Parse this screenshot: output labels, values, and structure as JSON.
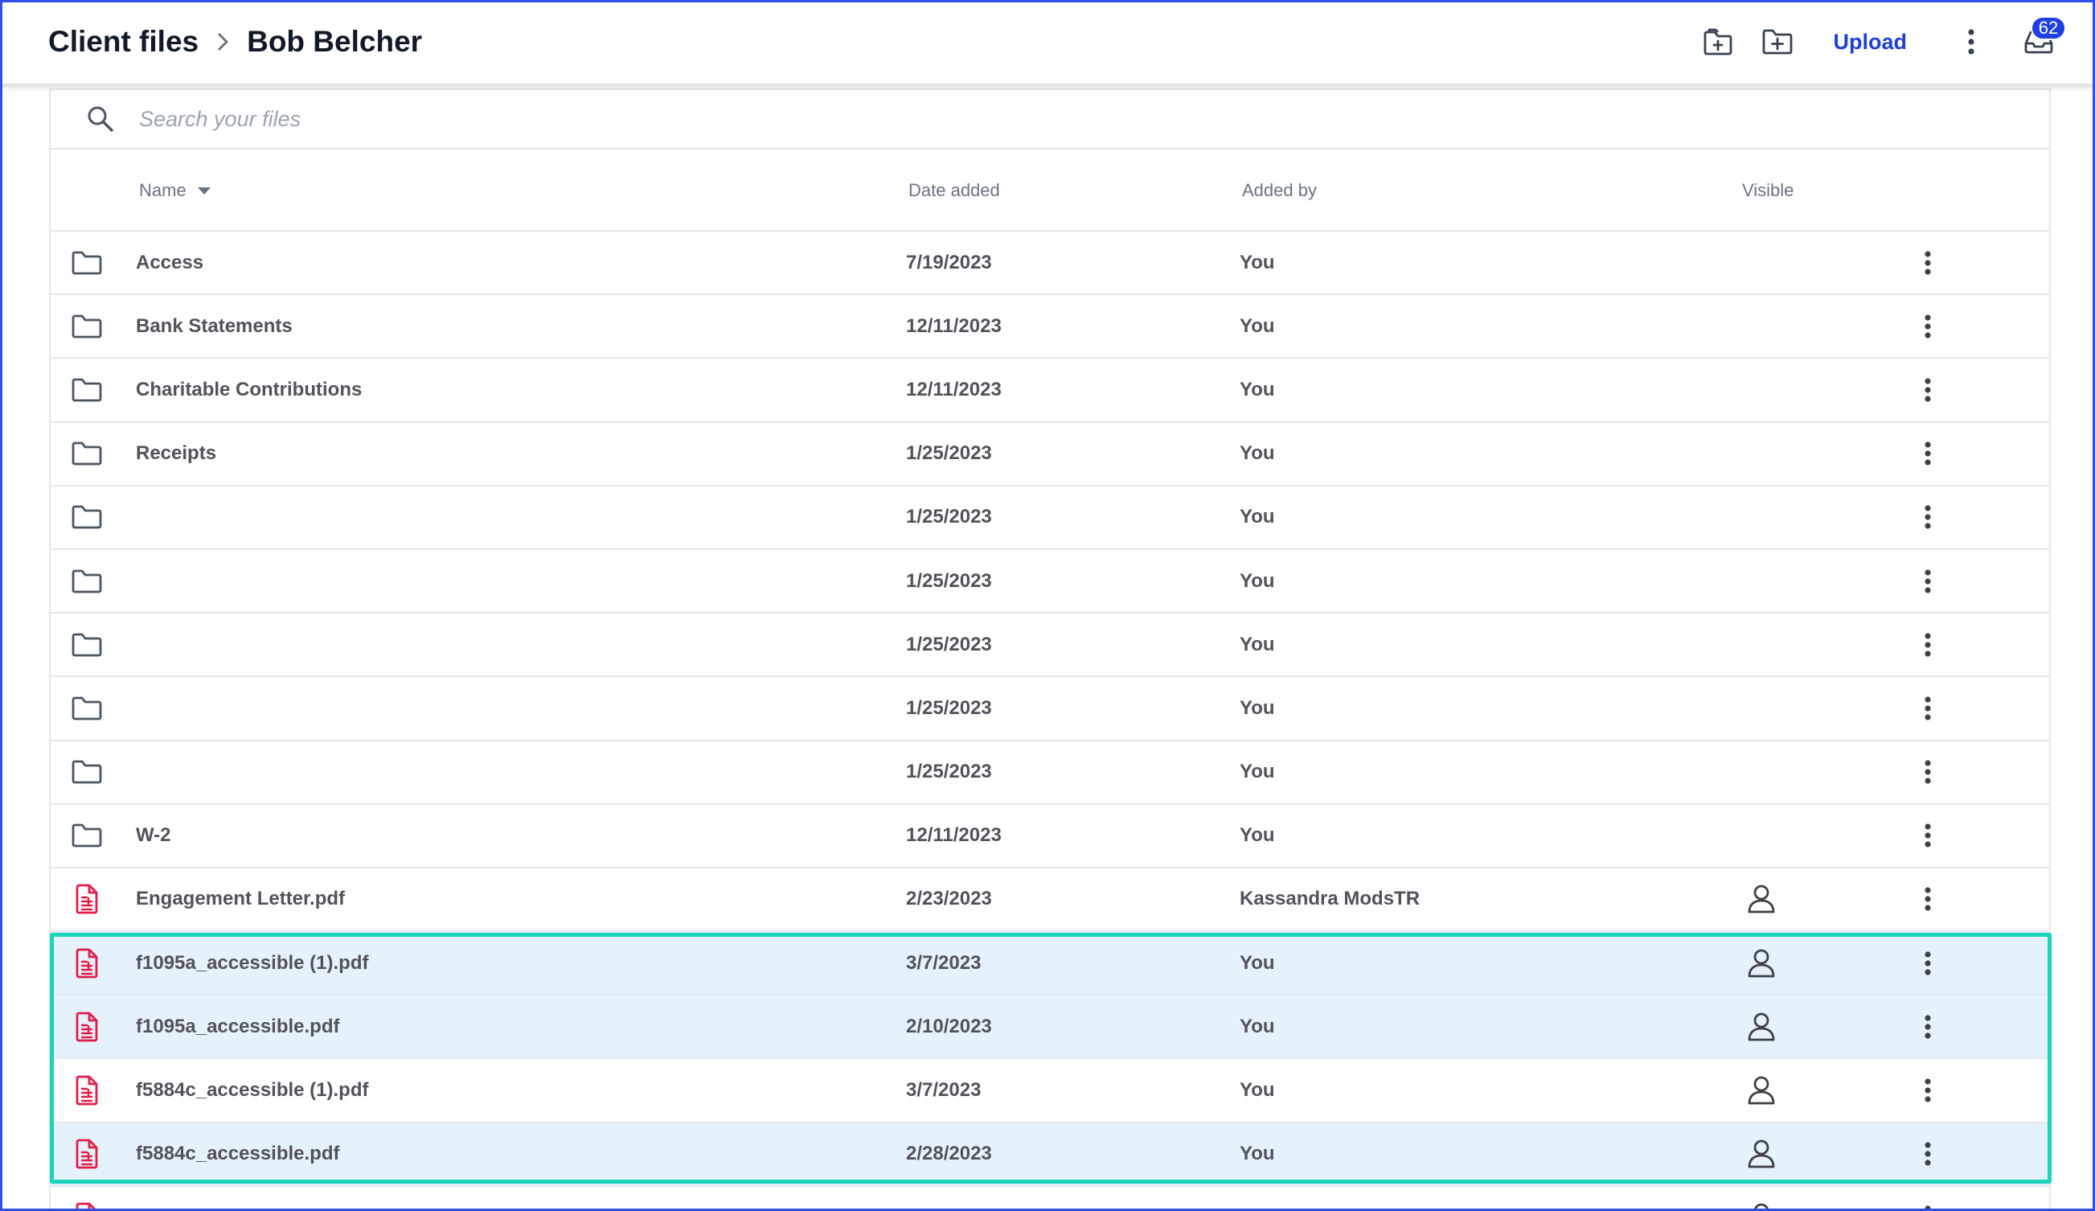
{
  "breadcrumb": {
    "root": "Client files",
    "current": "Bob Belcher"
  },
  "header": {
    "upload_label": "Upload",
    "inbox_count": "62"
  },
  "search": {
    "placeholder": "Search your files"
  },
  "columns": {
    "name": "Name",
    "date_added": "Date added",
    "added_by": "Added by",
    "visible": "Visible"
  },
  "rows": [
    {
      "type": "folder",
      "name": "Access",
      "date": "7/19/2023",
      "by": "You",
      "visible": false,
      "selected": false
    },
    {
      "type": "folder",
      "name": "Bank Statements",
      "date": "12/11/2023",
      "by": "You",
      "visible": false,
      "selected": false
    },
    {
      "type": "folder",
      "name": "Charitable Contributions",
      "date": "12/11/2023",
      "by": "You",
      "visible": false,
      "selected": false
    },
    {
      "type": "folder",
      "name": "Receipts",
      "date": "1/25/2023",
      "by": "You",
      "visible": false,
      "selected": false
    },
    {
      "type": "folder",
      "name": "",
      "date": "1/25/2023",
      "by": "You",
      "visible": false,
      "selected": false
    },
    {
      "type": "folder",
      "name": "",
      "date": "1/25/2023",
      "by": "You",
      "visible": false,
      "selected": false
    },
    {
      "type": "folder",
      "name": "",
      "date": "1/25/2023",
      "by": "You",
      "visible": false,
      "selected": false
    },
    {
      "type": "folder",
      "name": "",
      "date": "1/25/2023",
      "by": "You",
      "visible": false,
      "selected": false
    },
    {
      "type": "folder",
      "name": "",
      "date": "1/25/2023",
      "by": "You",
      "visible": false,
      "selected": false
    },
    {
      "type": "folder",
      "name": "W-2",
      "date": "12/11/2023",
      "by": "You",
      "visible": false,
      "selected": false
    },
    {
      "type": "pdf",
      "name": "Engagement Letter.pdf",
      "date": "2/23/2023",
      "by": "Kassandra ModsTR",
      "visible": true,
      "selected": false
    },
    {
      "type": "pdf",
      "name": "f1095a_accessible (1).pdf",
      "date": "3/7/2023",
      "by": "You",
      "visible": true,
      "selected": true
    },
    {
      "type": "pdf",
      "name": "f1095a_accessible.pdf",
      "date": "2/10/2023",
      "by": "You",
      "visible": true,
      "selected": true
    },
    {
      "type": "pdf",
      "name": "f5884c_accessible (1).pdf",
      "date": "3/7/2023",
      "by": "You",
      "visible": true,
      "selected": false
    },
    {
      "type": "pdf",
      "name": "f5884c_accessible.pdf",
      "date": "2/28/2023",
      "by": "You",
      "visible": true,
      "selected": true
    },
    {
      "type": "pdf",
      "name": "",
      "date": "",
      "by": "",
      "visible": true,
      "selected": false
    }
  ],
  "colors": {
    "accent": "#1d3fd8",
    "badge": "#2040e0",
    "pdf_icon": "#e11d48",
    "selection_bg": "#e6f2fb",
    "highlight_border": "#19d4bc",
    "frame_border": "#2f4de8"
  }
}
